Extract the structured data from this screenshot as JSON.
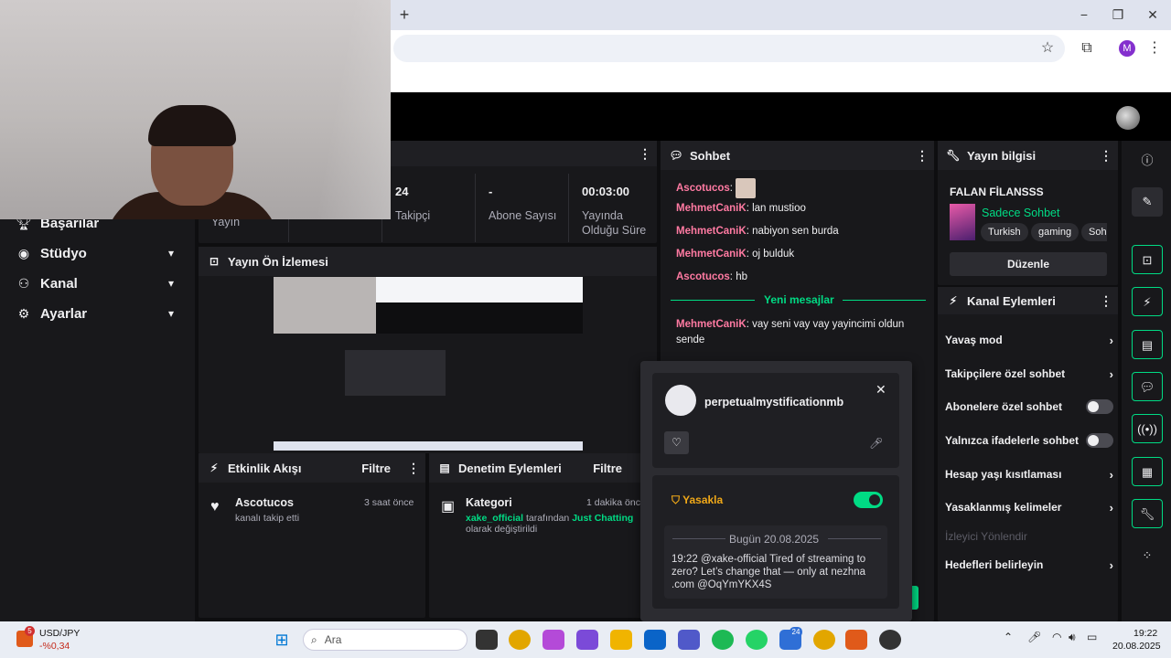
{
  "browser": {
    "new_tab": "+",
    "profile_initial": "M",
    "icons": [
      "star-icon",
      "extensions-icon",
      "more-icon"
    ],
    "window_controls": [
      "−",
      "❐",
      "✕"
    ]
  },
  "leftnav": {
    "items": [
      {
        "label": "Başarılar",
        "icon": "trophy-icon",
        "chev": ""
      },
      {
        "label": "Stüdyo",
        "icon": "camera-icon",
        "chev": "⌄"
      },
      {
        "label": "Kanal",
        "icon": "users-icon",
        "chev": "⌄"
      },
      {
        "label": "Ayarlar",
        "icon": "gear-icon",
        "chev": "⌄"
      }
    ]
  },
  "stats": {
    "items": [
      {
        "value": "",
        "label": "Yayın"
      },
      {
        "value": "24",
        "label": "Takipçi"
      },
      {
        "value": "-",
        "label": "Abone Sayısı"
      },
      {
        "value": "00:03:00",
        "label": "Yayında Olduğu Süre"
      }
    ]
  },
  "preview": {
    "title": "Yayın Ön İzlemesi"
  },
  "activity": {
    "title": "Etkinlik Akışı",
    "filter": "Filtre",
    "item": {
      "user": "Ascotucos",
      "time": "3 saat önce",
      "text": "kanalı takip etti"
    }
  },
  "moderation": {
    "title": "Denetim Eylemleri",
    "filter": "Filtre",
    "item": {
      "title": "Kategori",
      "time": "1 dakika önce",
      "actor": "xake_official",
      "mid": "tarafından",
      "target": "Just Chatting",
      "rest": "olarak değiştirildi"
    }
  },
  "chat": {
    "title": "Sohbet",
    "messages": [
      {
        "user": "Ascotucos",
        "color": "#ff7aa2",
        "text": ""
      },
      {
        "user": "MehmetCaniK",
        "color": "#ff7aa2",
        "text": "lan mustioo"
      },
      {
        "user": "MehmetCaniK",
        "color": "#ff7aa2",
        "text": "nabiyon sen burda"
      },
      {
        "user": "MehmetCaniK",
        "color": "#ff7aa2",
        "text": "oj bulduk"
      },
      {
        "user": "Ascotucos",
        "color": "#ff7aa2",
        "text": "hb"
      }
    ],
    "new_messages": "Yeni mesajlar",
    "after": {
      "user": "MehmetCaniK",
      "text": "vay seni vay vay yayincimi oldun sende"
    }
  },
  "info": {
    "title": "Yayın bilgisi",
    "stream_title": "FALAN FİLANSSS",
    "category": "Sadece Sohbet",
    "tags": [
      "Turkish",
      "gaming",
      "Soh"
    ],
    "edit": "Düzenle"
  },
  "channel_actions": {
    "title": "Kanal Eylemleri",
    "rows": [
      {
        "label": "Yavaş mod",
        "type": "chevron"
      },
      {
        "label": "Takipçilere özel sohbet",
        "type": "chevron"
      },
      {
        "label": "Abonelere özel sohbet",
        "type": "toggle"
      },
      {
        "label": "Yalnızca ifadelerle sohbet",
        "type": "toggle"
      },
      {
        "label": "Hesap yaşı kısıtlaması",
        "type": "chevron"
      },
      {
        "label": "Yasaklanmış kelimeler",
        "type": "chevron"
      }
    ],
    "section": "İzleyici Yönlendir",
    "goals": "Hedefleri belirleyin"
  },
  "popup": {
    "username": "perpetualmystificationmb",
    "ban_label": "Yasakla",
    "date": "Bugün 20.08.2025",
    "message": "19:22 @xake-official Tired of streaming to zero? Let’s change that — only at nezhna .com @OqYmYKX4S"
  },
  "taskbar": {
    "ticker": "USD/JPY",
    "ticker_change": "-%0,34",
    "ticker_badge": "5",
    "search": "Ara",
    "time": "19:22",
    "date": "20.08.2025",
    "badge": "24"
  },
  "colors": {
    "accent": "#00db84",
    "bg": "#0e0e10",
    "panel": "#18181b"
  }
}
